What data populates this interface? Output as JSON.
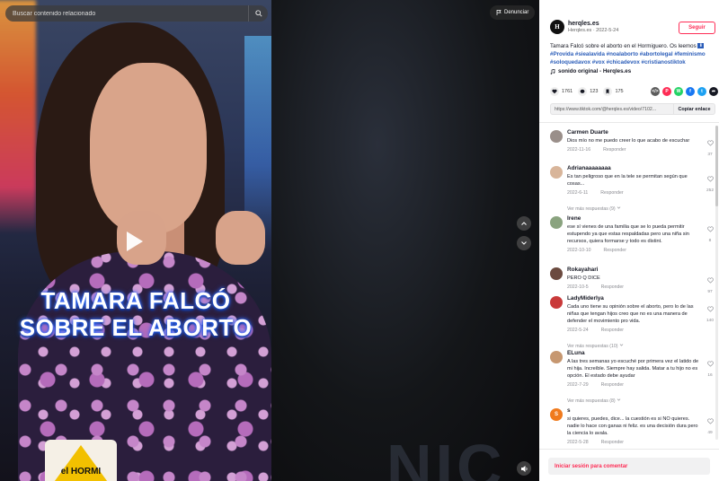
{
  "search": {
    "placeholder": "Buscar contenido relacionado"
  },
  "video": {
    "caption_line1": "TAMARA FALCÓ",
    "caption_line2": "SOBRE EL ABORTO",
    "mug_text": "el HORMI"
  },
  "report_label": "Denunciar",
  "author": {
    "avatar_letter": "H",
    "name": "herqles.es",
    "sub": "Herqles.es · 2022-5-24",
    "follow_label": "Seguir"
  },
  "description": {
    "text": "Tamara Falcó sobre el aborto en el Hormiguero. Os leemos",
    "flag": "⬇",
    "tags": [
      "#Provida",
      "#siealavida",
      "#noalaborto",
      "#abortolegal",
      "#feminismo",
      "#soloquedavox",
      "#vox",
      "#chicadevox",
      "#cristianostiktok"
    ]
  },
  "sound": {
    "label": "sonido original - Herqles.es"
  },
  "stats": {
    "likes": "1761",
    "comments": "123",
    "saves": "175"
  },
  "share_icons": [
    {
      "name": "embed-icon",
      "label": "</>",
      "color": "#5c5c5c"
    },
    {
      "name": "pinterest-icon",
      "label": "P",
      "color": "#fe2c55"
    },
    {
      "name": "whatsapp-icon",
      "label": "W",
      "color": "#25d366"
    },
    {
      "name": "facebook-icon",
      "label": "f",
      "color": "#1877f2"
    },
    {
      "name": "twitter-icon",
      "label": "t",
      "color": "#1da1f2"
    },
    {
      "name": "share-icon",
      "label": "➦",
      "color": "#161823"
    }
  ],
  "link": {
    "url": "https://www.tiktok.com/@herqles.es/video/7102...",
    "copy_label": "Copiar enlace"
  },
  "comments": [
    {
      "user": "Carmen Duarte",
      "text": "Dios mío no me puedo creer lo que acabo de escuchar",
      "date": "2022-11-16",
      "reply": "Responder",
      "likes": "37",
      "avatar_color": "#9a8f8a"
    },
    {
      "user": "Adrianaaaaaaaa",
      "text": "Es tan peligroso que en la tele se permitan según que cosas...",
      "date": "2022-6-11",
      "reply": "Responder",
      "likes": "252",
      "avatar_color": "#d8b59a",
      "more": "Ver más respuestas (9)"
    },
    {
      "user": "Irene",
      "text": "ese sí vienes de una familia que se lo pueda permitir estupendo ya que estas respaldadas pero una niña sin recursos, quiera formarse y todo es distint.",
      "date": "2022-10-10",
      "reply": "Responder",
      "likes": "8",
      "avatar_color": "#8aa37f"
    },
    {
      "user": "Rokayahari",
      "text": "PERO Q DICE",
      "date": "2022-10-5",
      "reply": "Responder",
      "likes": "97",
      "avatar_color": "#6b4a3f"
    },
    {
      "user": "LadyMiderlya",
      "text": "Cada uno tiene su opinión sobre el aborto, pero lo de las niñas que tengan hijos creo que no es una manera de defender el movimiento pro vida.",
      "date": "2022-5-24",
      "reply": "Responder",
      "likes": "140",
      "avatar_color": "#c93a3a",
      "more": "Ver más respuestas (10)"
    },
    {
      "user": "ELuna",
      "text": "A las tres semanas yo escuché por primera vez el latido de mi hija. Increíble. Siempre hay salida. Matar a tu hijo no es opción. El estado debe ayudar",
      "date": "2022-7-29",
      "reply": "Responder",
      "likes": "16",
      "avatar_color": "#c69770",
      "more": "Ver más respuestas (8)"
    },
    {
      "user": "s",
      "text": "si quieres, puedes, dice... la cuestión es si NO quieres. nadie lo hace con ganas ni feliz. es una decisión dura pero la ciencia lo avala.",
      "date": "2022-5-28",
      "reply": "Responder",
      "likes": "49",
      "avatar_color": "#f07a1d",
      "avatar_letter": "S"
    }
  ],
  "login": {
    "label": "Iniciar sesión para comentar"
  }
}
